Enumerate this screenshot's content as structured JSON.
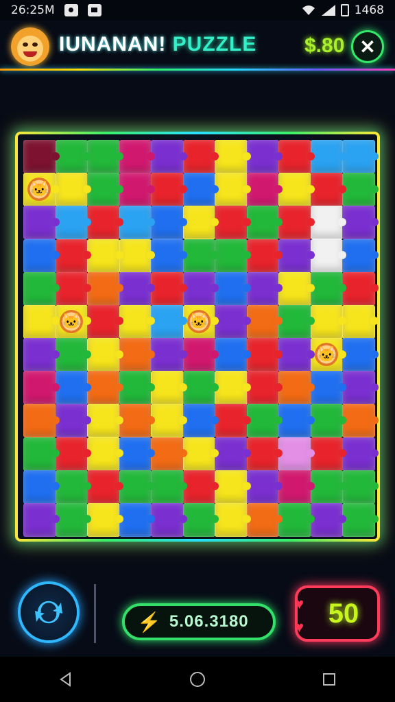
{
  "status_bar": {
    "time": "26:25M",
    "right_text": "1468"
  },
  "header": {
    "title_part1": "IUNANAN!",
    "title_part2": "PUZZLE",
    "money": "$.80"
  },
  "bottom": {
    "score": "5.06.3180",
    "lives": "50"
  },
  "colors": {
    "red": "#e8232b",
    "green": "#22b83a",
    "blue": "#1f6ff0",
    "yellow": "#f6e51c",
    "purple": "#7a2fd0",
    "orange": "#f36b14",
    "magenta": "#d1186f",
    "sky": "#2aa3f2"
  },
  "board": {
    "rows": 12,
    "cols": 11,
    "grid": [
      [
        "dark",
        "green",
        "green",
        "magenta",
        "purple",
        "red",
        "yellow",
        "purple",
        "red",
        "sky",
        "sky"
      ],
      [
        "creature",
        "yellow",
        "green",
        "magenta",
        "red",
        "blue",
        "yellow",
        "magenta",
        "yellow",
        "red",
        "green"
      ],
      [
        "purple",
        "sky",
        "red",
        "sky",
        "blue",
        "yellow",
        "red",
        "green",
        "red",
        "white",
        "purple"
      ],
      [
        "blue",
        "red",
        "yellow",
        "yellow",
        "blue",
        "green",
        "green",
        "red",
        "purple",
        "white",
        "blue"
      ],
      [
        "green",
        "red",
        "orange",
        "purple",
        "red",
        "purple",
        "blue",
        "purple",
        "yellow",
        "green",
        "red"
      ],
      [
        "yellow",
        "creature",
        "red",
        "yellow",
        "sky",
        "creature",
        "purple",
        "orange",
        "green",
        "yellow",
        "yellow"
      ],
      [
        "purple",
        "green",
        "yellow",
        "orange",
        "purple",
        "magenta",
        "blue",
        "red",
        "purple",
        "creature",
        "blue"
      ],
      [
        "magenta",
        "blue",
        "orange",
        "green",
        "yellow",
        "green",
        "yellow",
        "red",
        "orange",
        "blue",
        "purple"
      ],
      [
        "orange",
        "purple",
        "yellow",
        "orange",
        "yellow",
        "blue",
        "red",
        "green",
        "blue",
        "green",
        "orange"
      ],
      [
        "green",
        "red",
        "yellow",
        "blue",
        "orange",
        "yellow",
        "purple",
        "red",
        "pink",
        "red",
        "purple"
      ],
      [
        "blue",
        "green",
        "red",
        "green",
        "green",
        "red",
        "yellow",
        "purple",
        "magenta",
        "green",
        "green"
      ],
      [
        "purple",
        "green",
        "yellow",
        "blue",
        "purple",
        "green",
        "yellow",
        "orange",
        "green",
        "purple",
        "green"
      ]
    ]
  }
}
